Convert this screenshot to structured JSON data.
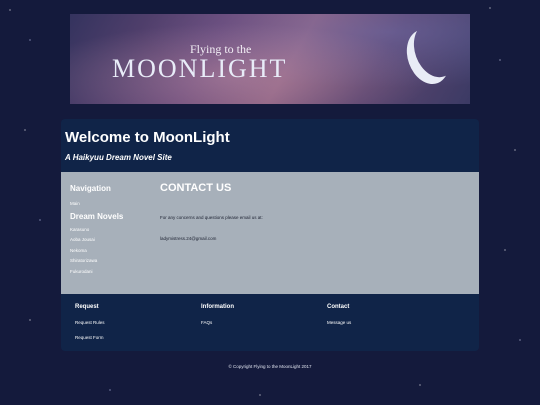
{
  "banner": {
    "subtitle": "Flying to the",
    "title": "MOONLIGHT"
  },
  "header": {
    "title": "Welcome to MoonLight",
    "subtitle": "A Haikyuu Dream Novel Site"
  },
  "sidebar": {
    "nav_heading": "Navigation",
    "nav_items": [
      {
        "label": "Main"
      }
    ],
    "novels_heading": "Dream Novels",
    "novel_items": [
      {
        "label": "Karasuno"
      },
      {
        "label": "Aoba Jousai"
      },
      {
        "label": "Nekoma"
      },
      {
        "label": "Shiratorizawa"
      },
      {
        "label": "Fukurodani"
      }
    ]
  },
  "content": {
    "heading": "CONTACT US",
    "text": "For any concerns and questions please email us at:",
    "email": "ladymistress.24@gmail.com"
  },
  "footer": {
    "columns": [
      {
        "heading": "Request",
        "links": [
          {
            "label": "Request Rules"
          },
          {
            "label": "Request Form"
          }
        ]
      },
      {
        "heading": "Information",
        "links": [
          {
            "label": "FAQs"
          }
        ]
      },
      {
        "heading": "Contact",
        "links": [
          {
            "label": "Message us"
          }
        ]
      }
    ]
  },
  "copyright": "© Copyright   Flying to the MoonLight 2017",
  "colors": {
    "background": "#141a3c",
    "panel": "#102448",
    "content_bg": "#a7b0ba"
  }
}
